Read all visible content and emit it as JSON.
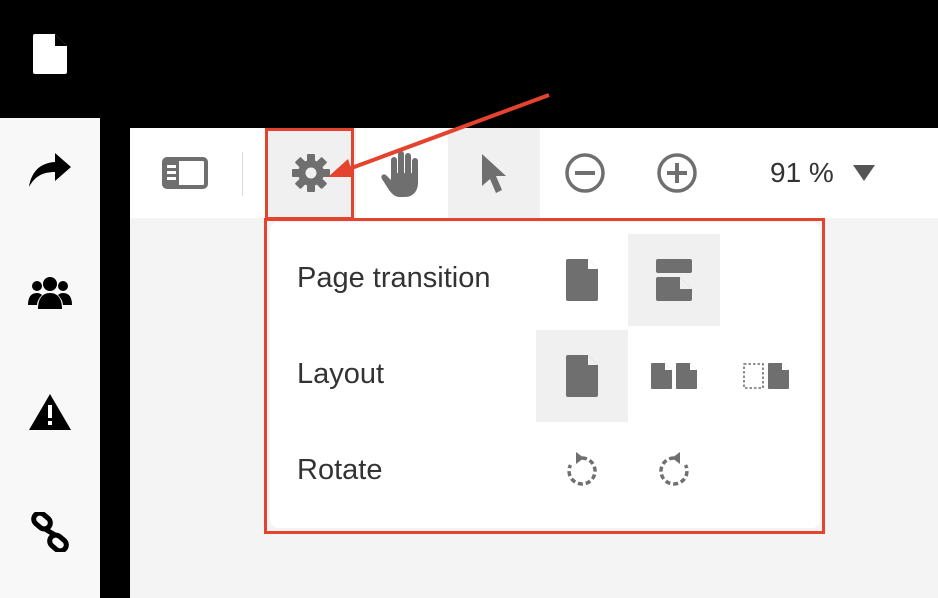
{
  "toolbar": {
    "zoom_value": "91 %"
  },
  "menu": {
    "page_transition_label": "Page transition",
    "layout_label": "Layout",
    "rotate_label": "Rotate"
  },
  "colors": {
    "annotation": "#e4432d",
    "icon": "#6f6f6f",
    "selected_bg": "#f0f0f0"
  }
}
